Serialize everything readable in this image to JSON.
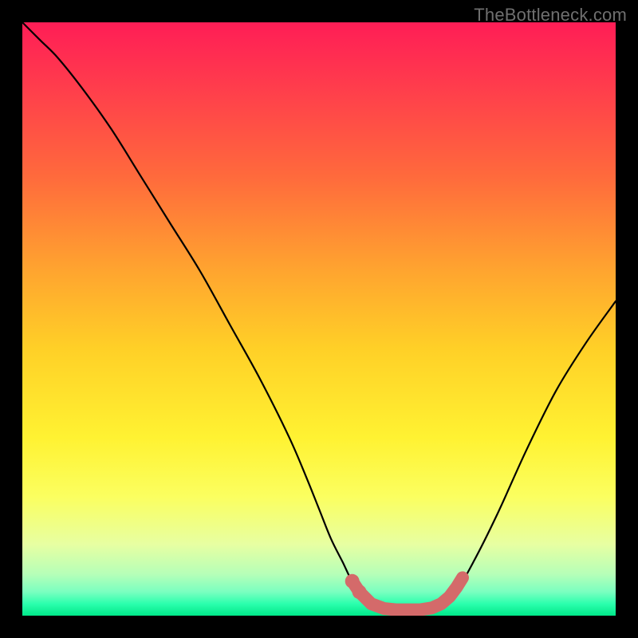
{
  "attribution": "TheBottleneck.com",
  "chart_data": {
    "type": "line",
    "title": "",
    "xlabel": "",
    "ylabel": "",
    "xlim": [
      0,
      100
    ],
    "ylim": [
      0,
      100
    ],
    "series": [
      {
        "name": "bottleneck-curve",
        "x": [
          0,
          3,
          6,
          10,
          15,
          20,
          25,
          30,
          35,
          40,
          45,
          48,
          50,
          52,
          54,
          56,
          58,
          60,
          62,
          65,
          68,
          70,
          73,
          76,
          80,
          85,
          90,
          95,
          100
        ],
        "y": [
          100,
          97,
          94,
          89,
          82,
          74,
          66,
          58,
          49,
          40,
          30,
          23,
          18,
          13,
          9,
          5,
          3,
          1.5,
          1,
          1,
          1,
          1.5,
          4,
          9,
          17,
          28,
          38,
          46,
          53
        ]
      }
    ],
    "markers": {
      "name": "optimal-zone",
      "color": "#d46a6a",
      "points": [
        {
          "x": 55.6,
          "y": 5.8
        },
        {
          "x": 56.8,
          "y": 4.0
        },
        {
          "x": 58.8,
          "y": 2.0
        },
        {
          "x": 61.0,
          "y": 1.2
        },
        {
          "x": 63.0,
          "y": 1.0
        },
        {
          "x": 65.0,
          "y": 1.0
        },
        {
          "x": 67.0,
          "y": 1.0
        },
        {
          "x": 69.0,
          "y": 1.3
        },
        {
          "x": 70.6,
          "y": 2.0
        },
        {
          "x": 72.0,
          "y": 3.2
        },
        {
          "x": 73.2,
          "y": 4.8
        },
        {
          "x": 74.2,
          "y": 6.4
        }
      ]
    },
    "gradient_stops": [
      {
        "pos": 0.0,
        "color": "#ff1d56"
      },
      {
        "pos": 0.1,
        "color": "#ff3a4d"
      },
      {
        "pos": 0.26,
        "color": "#ff6a3c"
      },
      {
        "pos": 0.42,
        "color": "#ffa52f"
      },
      {
        "pos": 0.55,
        "color": "#ffd027"
      },
      {
        "pos": 0.7,
        "color": "#fff232"
      },
      {
        "pos": 0.8,
        "color": "#fbff60"
      },
      {
        "pos": 0.88,
        "color": "#e7ffa2"
      },
      {
        "pos": 0.93,
        "color": "#b6ffb8"
      },
      {
        "pos": 0.96,
        "color": "#7affc0"
      },
      {
        "pos": 0.98,
        "color": "#2bffad"
      },
      {
        "pos": 1.0,
        "color": "#00e889"
      }
    ]
  }
}
